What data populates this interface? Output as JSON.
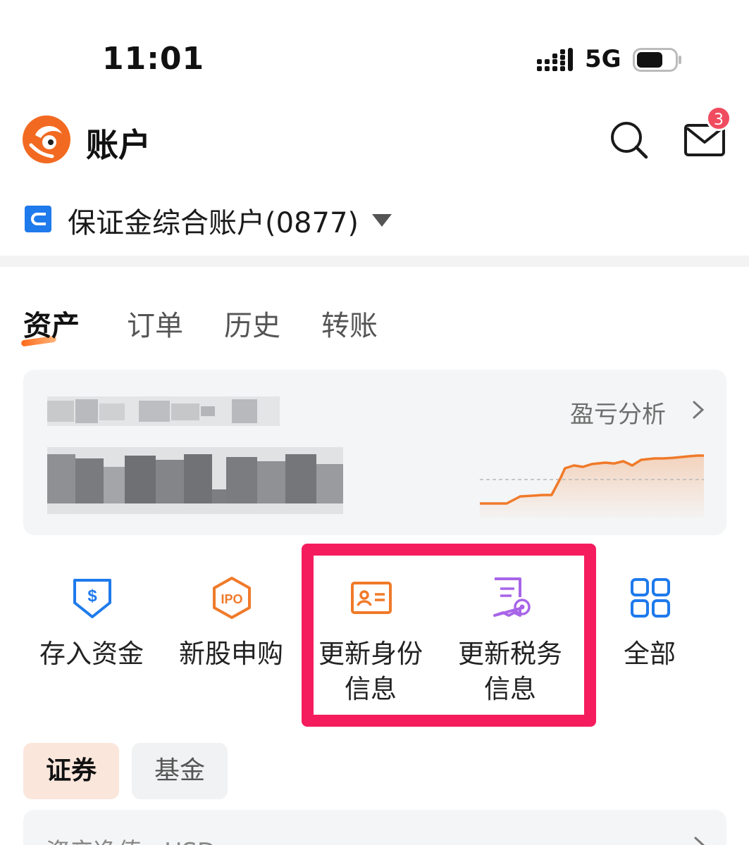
{
  "status_bar": {
    "time": "11:01",
    "network": "5G"
  },
  "header": {
    "title": "账户",
    "unread_count": "3",
    "brand_color": "#f26a22"
  },
  "account": {
    "name": "保证金综合账户(0877)"
  },
  "tabs": [
    {
      "label": "资产",
      "active": true
    },
    {
      "label": "订单",
      "active": false
    },
    {
      "label": "历史",
      "active": false
    },
    {
      "label": "转账",
      "active": false
    }
  ],
  "asset_card": {
    "pl_link": "盈亏分析",
    "value_obscured": true
  },
  "chart_data": {
    "type": "line",
    "title": "",
    "xlabel": "",
    "ylabel": "",
    "color": "#f07a2a",
    "points": [
      [
        0,
        3.0
      ],
      [
        12,
        3.0
      ],
      [
        18,
        5.5
      ],
      [
        28,
        6.0
      ],
      [
        32,
        6.0
      ],
      [
        36,
        12.0
      ],
      [
        38,
        15.5
      ],
      [
        42,
        16.5
      ],
      [
        46,
        16.0
      ],
      [
        50,
        17.0
      ],
      [
        56,
        17.5
      ],
      [
        60,
        17.2
      ],
      [
        64,
        18.0
      ],
      [
        68,
        16.5
      ],
      [
        72,
        18.5
      ],
      [
        78,
        19.0
      ],
      [
        82,
        19.0
      ],
      [
        86,
        19.2
      ],
      [
        90,
        19.5
      ],
      [
        94,
        19.8
      ],
      [
        97,
        20.0
      ],
      [
        100,
        20.0
      ]
    ],
    "baseline": 11.5,
    "xlim": [
      0,
      100
    ],
    "ylim": [
      0,
      24
    ]
  },
  "actions": [
    {
      "label": "存入资金",
      "icon": "deposit-icon"
    },
    {
      "label": "新股申购",
      "icon": "ipo-icon"
    },
    {
      "label": "更新身份信息",
      "icon": "id-card-icon"
    },
    {
      "label": "更新税务信息",
      "icon": "tax-document-icon"
    },
    {
      "label": "全部",
      "icon": "grid-icon"
    }
  ],
  "highlight_color": "#f51c5e",
  "sub_tabs": [
    {
      "label": "证券",
      "active": true
    },
    {
      "label": "基金",
      "active": false
    }
  ],
  "bottom_card": {
    "label": "资产净值 · USD"
  }
}
